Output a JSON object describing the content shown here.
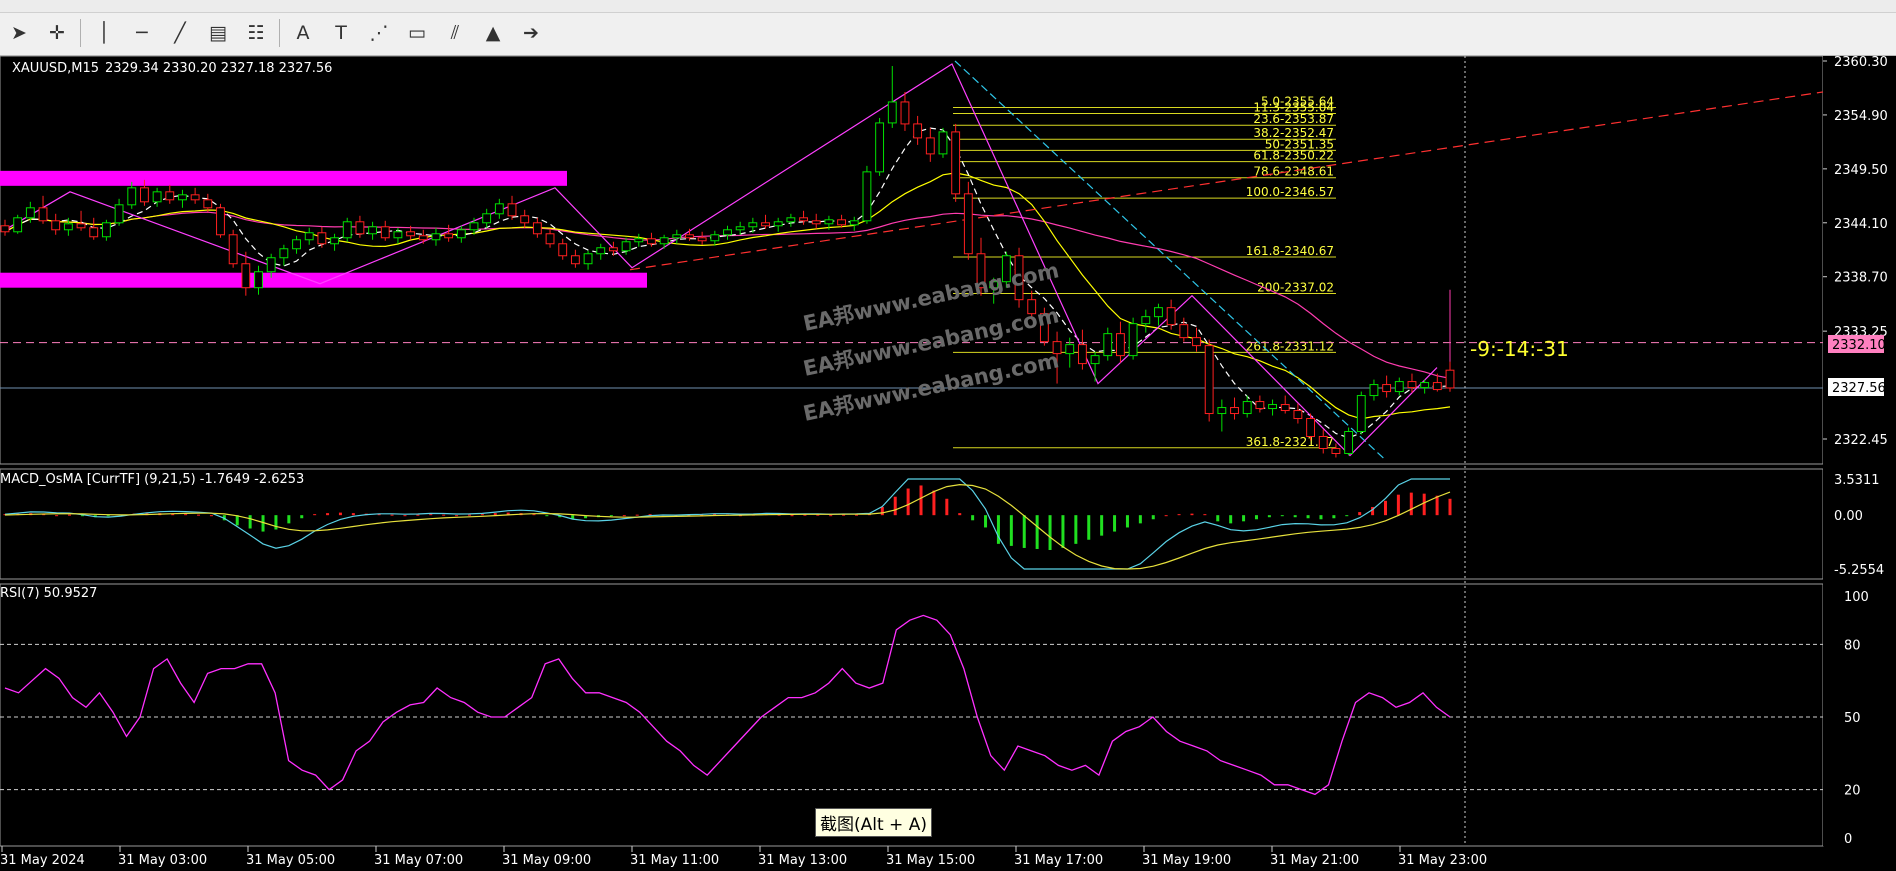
{
  "chart_header": {
    "symbol_tf": "XAUUSD,M15",
    "ohlc": "2329.34 2330.20 2327.18 2327.56"
  },
  "macd_label": "MACD_OsMA [CurrTF] (9,21,5) -1.7649 -2.6253",
  "rsi_label": "RSI(7) 50.9527",
  "countdown": "-9:-14:-31",
  "tooltip": "截图(Alt + A)",
  "watermark": "EA邦www.eabang.com",
  "price_badges": {
    "resistance": "2332.10",
    "current": "2327.56"
  },
  "toolbar": {
    "icons": [
      "cursor-icon",
      "crosshair-icon",
      "vertical-line-icon",
      "horizontal-line-icon",
      "trendline-icon",
      "fibo-expansion-icon",
      "fibo-fan-icon",
      "text-icon",
      "text-label-icon",
      "gann-fan-icon",
      "rectangle-icon",
      "channel-icon",
      "triangle-icon",
      "arrow-icon"
    ]
  },
  "chart_data": [
    {
      "type": "candlestick",
      "title": "XAUUSD,M15",
      "y_ticks": [
        "2360.30",
        "2354.90",
        "2349.50",
        "2344.10",
        "2338.70",
        "2333.25",
        "2327.56",
        "2322.45"
      ],
      "x_ticks": [
        "31 May 2024",
        "31 May 03:00",
        "31 May 05:00",
        "31 May 07:00",
        "31 May 09:00",
        "31 May 11:00",
        "31 May 13:00",
        "31 May 15:00",
        "31 May 17:00",
        "31 May 19:00",
        "31 May 21:00",
        "31 May 23:00"
      ],
      "ylim": [
        2320.2,
        2362.4
      ],
      "fibonacci_levels": [
        {
          "label": "5.0-2355.64",
          "value": 2355.64
        },
        {
          "label": "11.3-2355.04",
          "value": 2355.04
        },
        {
          "label": "23.6-2353.87",
          "value": 2353.87
        },
        {
          "label": "38.2-2352.47",
          "value": 2352.47
        },
        {
          "label": "50-2351.35",
          "value": 2351.35
        },
        {
          "label": "61.8-2350.22",
          "value": 2350.22
        },
        {
          "label": "78.6-2348.61",
          "value": 2348.61
        },
        {
          "label": "100.0-2346.57",
          "value": 2346.57
        },
        {
          "label": "161.8-2340.67",
          "value": 2340.67
        },
        {
          "label": "200-2337.02",
          "value": 2337.02
        },
        {
          "label": "261.8-2331.12",
          "value": 2331.12
        },
        {
          "label": "361.8-2321.57",
          "value": 2321.57
        }
      ],
      "horizontal_lines": [
        {
          "name": "resistance",
          "value": 2332.1,
          "color": "#ff80c0"
        },
        {
          "name": "bid",
          "value": 2327.56,
          "color": "#6f8fb0"
        }
      ],
      "zones": [
        {
          "name": "upper-zone",
          "from": 2347.8,
          "to": 2349.3,
          "color": "#ff00ff"
        },
        {
          "name": "lower-zone",
          "from": 2337.6,
          "to": 2339.1,
          "color": "#ff00ff"
        }
      ],
      "candles": [
        [
          2343.8,
          2344.4,
          2342.8,
          2343.2
        ],
        [
          2343.2,
          2344.9,
          2343.0,
          2344.6
        ],
        [
          2344.6,
          2346.2,
          2344.1,
          2345.6
        ],
        [
          2345.6,
          2346.8,
          2344.0,
          2344.3
        ],
        [
          2344.3,
          2345.0,
          2342.9,
          2343.4
        ],
        [
          2343.4,
          2344.6,
          2342.8,
          2344.0
        ],
        [
          2344.0,
          2345.3,
          2343.3,
          2343.6
        ],
        [
          2343.6,
          2344.6,
          2342.4,
          2342.7
        ],
        [
          2342.7,
          2344.4,
          2342.3,
          2344.1
        ],
        [
          2344.1,
          2346.5,
          2343.8,
          2345.9
        ],
        [
          2345.9,
          2348.2,
          2345.5,
          2347.6
        ],
        [
          2347.6,
          2348.4,
          2345.8,
          2346.2
        ],
        [
          2346.2,
          2347.6,
          2345.7,
          2347.2
        ],
        [
          2347.2,
          2347.9,
          2346.0,
          2346.4
        ],
        [
          2346.4,
          2347.4,
          2345.6,
          2346.9
        ],
        [
          2346.9,
          2347.6,
          2346.0,
          2346.4
        ],
        [
          2346.4,
          2347.0,
          2345.2,
          2345.6
        ],
        [
          2345.6,
          2346.0,
          2342.6,
          2342.9
        ],
        [
          2342.9,
          2343.4,
          2339.6,
          2340.0
        ],
        [
          2340.0,
          2341.2,
          2336.8,
          2337.6
        ],
        [
          2337.6,
          2339.8,
          2336.9,
          2339.2
        ],
        [
          2339.2,
          2341.0,
          2338.6,
          2340.6
        ],
        [
          2340.6,
          2341.9,
          2339.8,
          2341.5
        ],
        [
          2341.5,
          2342.8,
          2341.0,
          2342.4
        ],
        [
          2342.4,
          2343.6,
          2341.9,
          2343.1
        ],
        [
          2343.1,
          2343.7,
          2341.6,
          2342.0
        ],
        [
          2342.0,
          2343.0,
          2341.3,
          2342.6
        ],
        [
          2342.6,
          2344.6,
          2342.2,
          2344.2
        ],
        [
          2344.2,
          2344.8,
          2342.6,
          2343.0
        ],
        [
          2343.0,
          2344.2,
          2342.4,
          2343.7
        ],
        [
          2343.7,
          2344.3,
          2342.3,
          2342.6
        ],
        [
          2342.6,
          2343.6,
          2342.0,
          2343.2
        ],
        [
          2343.2,
          2343.8,
          2342.4,
          2342.8
        ],
        [
          2342.8,
          2343.4,
          2342.0,
          2342.4
        ],
        [
          2342.4,
          2343.6,
          2341.8,
          2343.0
        ],
        [
          2343.0,
          2343.9,
          2342.2,
          2342.6
        ],
        [
          2342.6,
          2343.8,
          2342.1,
          2343.4
        ],
        [
          2343.4,
          2344.6,
          2342.9,
          2344.1
        ],
        [
          2344.1,
          2345.5,
          2343.6,
          2345.0
        ],
        [
          2345.0,
          2346.5,
          2344.5,
          2346.0
        ],
        [
          2346.0,
          2346.8,
          2344.4,
          2344.8
        ],
        [
          2344.8,
          2345.4,
          2343.6,
          2344.1
        ],
        [
          2344.1,
          2344.6,
          2342.6,
          2343.0
        ],
        [
          2343.0,
          2343.5,
          2341.6,
          2342.0
        ],
        [
          2342.0,
          2342.5,
          2340.4,
          2340.8
        ],
        [
          2340.8,
          2341.4,
          2339.6,
          2340.0
        ],
        [
          2340.0,
          2341.3,
          2339.4,
          2341.0
        ],
        [
          2341.0,
          2342.0,
          2340.4,
          2341.6
        ],
        [
          2341.6,
          2342.2,
          2340.8,
          2341.3
        ],
        [
          2341.3,
          2342.6,
          2340.9,
          2342.2
        ],
        [
          2342.2,
          2343.0,
          2341.7,
          2342.5
        ],
        [
          2342.5,
          2343.1,
          2341.7,
          2342.0
        ],
        [
          2342.0,
          2342.9,
          2341.5,
          2342.6
        ],
        [
          2342.6,
          2343.4,
          2342.0,
          2342.9
        ],
        [
          2342.9,
          2343.5,
          2342.3,
          2342.6
        ],
        [
          2342.6,
          2343.2,
          2341.9,
          2342.3
        ],
        [
          2342.3,
          2343.3,
          2341.8,
          2342.9
        ],
        [
          2342.9,
          2343.8,
          2342.4,
          2343.4
        ],
        [
          2343.4,
          2344.2,
          2342.9,
          2343.7
        ],
        [
          2343.7,
          2344.6,
          2343.1,
          2344.1
        ],
        [
          2344.1,
          2344.9,
          2343.5,
          2343.8
        ],
        [
          2343.8,
          2344.6,
          2343.2,
          2344.2
        ],
        [
          2344.2,
          2345.0,
          2343.7,
          2344.6
        ],
        [
          2344.6,
          2345.3,
          2343.9,
          2344.3
        ],
        [
          2344.3,
          2345.0,
          2343.5,
          2344.0
        ],
        [
          2344.0,
          2344.8,
          2343.4,
          2344.4
        ],
        [
          2344.4,
          2344.9,
          2343.6,
          2343.9
        ],
        [
          2343.9,
          2344.7,
          2343.3,
          2344.3
        ],
        [
          2344.3,
          2349.8,
          2344.0,
          2349.2
        ],
        [
          2349.2,
          2354.6,
          2348.8,
          2354.1
        ],
        [
          2354.1,
          2359.8,
          2353.6,
          2356.2
        ],
        [
          2356.2,
          2357.2,
          2353.3,
          2354.0
        ],
        [
          2354.0,
          2354.8,
          2351.9,
          2352.6
        ],
        [
          2352.6,
          2353.6,
          2350.2,
          2351.0
        ],
        [
          2351.0,
          2353.6,
          2350.6,
          2353.2
        ],
        [
          2353.2,
          2354.0,
          2346.2,
          2347.0
        ],
        [
          2347.0,
          2348.2,
          2340.4,
          2341.0
        ],
        [
          2341.0,
          2342.6,
          2336.8,
          2337.6
        ],
        [
          2337.6,
          2338.6,
          2336.0,
          2338.2
        ],
        [
          2338.2,
          2341.2,
          2337.6,
          2340.8
        ],
        [
          2340.8,
          2341.6,
          2335.6,
          2336.4
        ],
        [
          2336.4,
          2337.3,
          2334.4,
          2335.0
        ],
        [
          2335.0,
          2335.6,
          2331.8,
          2332.2
        ],
        [
          2332.2,
          2333.2,
          2328.0,
          2331.0
        ],
        [
          2331.0,
          2332.6,
          2329.6,
          2331.9
        ],
        [
          2331.9,
          2333.4,
          2329.4,
          2330.0
        ],
        [
          2330.0,
          2331.2,
          2328.2,
          2330.8
        ],
        [
          2330.8,
          2333.6,
          2330.3,
          2333.0
        ],
        [
          2333.0,
          2334.2,
          2330.1,
          2330.8
        ],
        [
          2330.8,
          2334.6,
          2330.4,
          2334.0
        ],
        [
          2334.0,
          2335.4,
          2333.1,
          2334.7
        ],
        [
          2334.7,
          2336.0,
          2333.8,
          2335.6
        ],
        [
          2335.6,
          2336.4,
          2333.4,
          2333.9
        ],
        [
          2333.9,
          2334.6,
          2332.2,
          2332.6
        ],
        [
          2332.6,
          2333.6,
          2331.2,
          2331.8
        ],
        [
          2331.8,
          2332.4,
          2324.2,
          2325.0
        ],
        [
          2325.0,
          2326.4,
          2323.2,
          2325.6
        ],
        [
          2325.6,
          2326.6,
          2324.4,
          2325.0
        ],
        [
          2325.0,
          2326.8,
          2324.6,
          2326.2
        ],
        [
          2326.2,
          2326.8,
          2325.1,
          2325.5
        ],
        [
          2325.5,
          2326.4,
          2324.8,
          2325.9
        ],
        [
          2325.9,
          2326.8,
          2325.0,
          2325.3
        ],
        [
          2325.3,
          2326.0,
          2324.0,
          2324.5
        ],
        [
          2324.5,
          2325.0,
          2322.3,
          2322.7
        ],
        [
          2322.7,
          2323.4,
          2321.0,
          2321.5
        ],
        [
          2321.5,
          2322.0,
          2320.6,
          2321.0
        ],
        [
          2321.0,
          2323.6,
          2320.8,
          2323.2
        ],
        [
          2323.2,
          2327.2,
          2322.9,
          2326.8
        ],
        [
          2326.8,
          2328.4,
          2326.3,
          2327.9
        ],
        [
          2327.9,
          2328.8,
          2326.6,
          2327.2
        ],
        [
          2327.2,
          2328.6,
          2326.8,
          2328.2
        ],
        [
          2328.2,
          2329.0,
          2327.1,
          2327.6
        ],
        [
          2327.6,
          2328.4,
          2327.0,
          2328.1
        ],
        [
          2328.1,
          2329.0,
          2327.2,
          2327.4
        ],
        [
          2329.34,
          2330.2,
          2327.18,
          2327.56
        ]
      ],
      "indicator_lines": [
        {
          "name": "fast-ma",
          "color": "#ffffff",
          "dashed": true
        },
        {
          "name": "slow-ma",
          "color": "#ffff00"
        },
        {
          "name": "long-ma",
          "color": "#ff3cb0"
        },
        {
          "name": "zigzag",
          "color": "#ff40ff"
        },
        {
          "name": "trend-channel",
          "color": "#ff3030",
          "dashed": true
        },
        {
          "name": "down-trend",
          "color": "#2ec6e8",
          "dashed": true
        }
      ]
    },
    {
      "type": "bar",
      "title": "MACD_OsMA [CurrTF] (9,21,5)",
      "y_ticks": [
        "3.5311",
        "0.00",
        "-5.2554"
      ],
      "ylim": [
        -5.2554,
        3.5311
      ],
      "histogram": [
        0.1,
        0.15,
        0.2,
        0.1,
        0,
        0.05,
        -0.1,
        -0.2,
        -0.1,
        0.05,
        0.15,
        0.2,
        0.2,
        0.15,
        0.1,
        0.05,
        0,
        -0.5,
        -1.0,
        -1.3,
        -1.6,
        -1.4,
        -0.8,
        -0.3,
        0.1,
        0.2,
        0.25,
        0.2,
        0.15,
        0.1,
        0.05,
        0,
        0.05,
        0.1,
        0.05,
        0,
        0.05,
        0.1,
        0.2,
        0.25,
        0.2,
        0.1,
        -0.1,
        -0.2,
        -0.4,
        -0.3,
        -0.2,
        -0.1,
        0,
        0.05,
        0.1,
        0.05,
        0,
        0.05,
        0.05,
        0.1,
        0.05,
        0,
        0.05,
        0.1,
        0.05,
        0,
        0.05,
        0.05,
        0,
        0.05,
        0.05,
        0.1,
        0.8,
        1.8,
        2.6,
        2.9,
        2.4,
        1.6,
        0.2,
        -0.5,
        -1.2,
        -2.8,
        -3.0,
        -3.2,
        -3.3,
        -3.4,
        -3.2,
        -2.8,
        -2.4,
        -2.0,
        -1.6,
        -1.2,
        -0.8,
        -0.4,
        0,
        0.1,
        0.15,
        0.1,
        -0.6,
        -0.8,
        -0.6,
        -0.4,
        -0.2,
        -0.1,
        -0.2,
        -0.3,
        -0.4,
        -0.3,
        -0.1,
        0.3,
        0.8,
        1.4,
        2.0,
        2.2,
        2.1,
        1.9,
        1.6
      ],
      "signal_colors": {
        "macd": "#5ad2e6",
        "signal": "#e6e03c",
        "up": "#ff2020",
        "down": "#20e020"
      }
    },
    {
      "type": "line",
      "title": "RSI(7)",
      "y_ticks": [
        "100",
        "80",
        "50",
        "20",
        "0"
      ],
      "ylim": [
        0,
        100
      ],
      "levels": [
        80,
        50,
        20
      ],
      "values": [
        62,
        60,
        65,
        70,
        66,
        58,
        54,
        60,
        52,
        42,
        50,
        70,
        74,
        64,
        56,
        68,
        70,
        70,
        72,
        72,
        60,
        32,
        28,
        26,
        20,
        24,
        36,
        40,
        48,
        52,
        55,
        56,
        62,
        58,
        56,
        52,
        50,
        50,
        54,
        58,
        72,
        74,
        66,
        60,
        60,
        58,
        56,
        52,
        46,
        40,
        36,
        30,
        26,
        32,
        38,
        44,
        50,
        54,
        58,
        58,
        60,
        64,
        70,
        64,
        62,
        64,
        86,
        90,
        92,
        90,
        84,
        70,
        50,
        34,
        28,
        38,
        36,
        34,
        30,
        28,
        30,
        26,
        40,
        44,
        46,
        50,
        44,
        40,
        38,
        36,
        32,
        30,
        28,
        26,
        22,
        22,
        20,
        18,
        22,
        40,
        56,
        60,
        58,
        54,
        56,
        60,
        54,
        50
      ]
    }
  ]
}
